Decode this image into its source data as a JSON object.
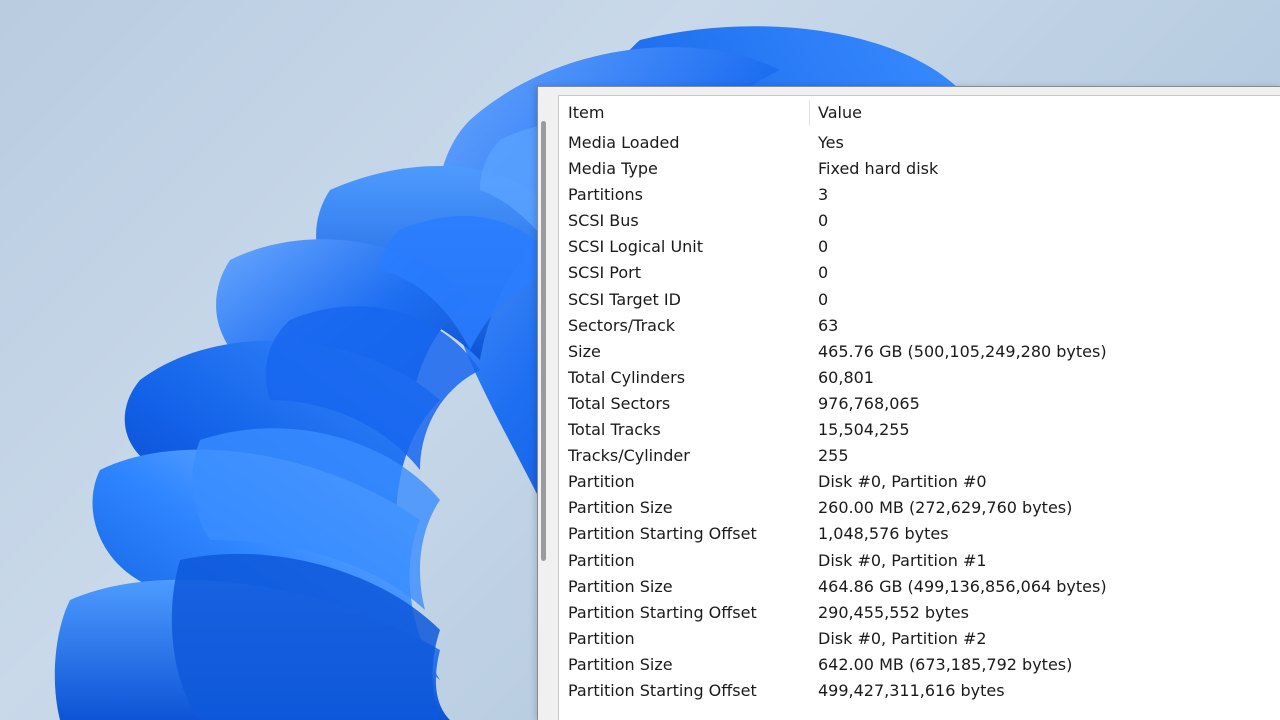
{
  "table": {
    "columns": [
      "Item",
      "Value"
    ],
    "rows": [
      {
        "item": "Media Loaded",
        "value": "Yes"
      },
      {
        "item": "Media Type",
        "value": "Fixed hard disk"
      },
      {
        "item": "Partitions",
        "value": "3"
      },
      {
        "item": "SCSI Bus",
        "value": "0"
      },
      {
        "item": "SCSI Logical Unit",
        "value": "0"
      },
      {
        "item": "SCSI Port",
        "value": "0"
      },
      {
        "item": "SCSI Target ID",
        "value": "0"
      },
      {
        "item": "Sectors/Track",
        "value": "63"
      },
      {
        "item": "Size",
        "value": "465.76 GB (500,105,249,280 bytes)"
      },
      {
        "item": "Total Cylinders",
        "value": "60,801"
      },
      {
        "item": "Total Sectors",
        "value": "976,768,065"
      },
      {
        "item": "Total Tracks",
        "value": "15,504,255"
      },
      {
        "item": "Tracks/Cylinder",
        "value": "255"
      },
      {
        "item": "Partition",
        "value": "Disk #0, Partition #0"
      },
      {
        "item": "Partition Size",
        "value": "260.00 MB (272,629,760 bytes)"
      },
      {
        "item": "Partition Starting Offset",
        "value": "1,048,576 bytes"
      },
      {
        "item": "Partition",
        "value": "Disk #0, Partition #1"
      },
      {
        "item": "Partition Size",
        "value": "464.86 GB (499,136,856,064 bytes)"
      },
      {
        "item": "Partition Starting Offset",
        "value": "290,455,552 bytes"
      },
      {
        "item": "Partition",
        "value": "Disk #0, Partition #2"
      },
      {
        "item": "Partition Size",
        "value": "642.00 MB (673,185,792 bytes)"
      },
      {
        "item": "Partition Starting Offset",
        "value": "499,427,311,616 bytes"
      }
    ]
  },
  "colors": {
    "wallpaper_bg": "#c3d4e6",
    "bloom_blue": "#1a6cf0",
    "window_bg": "#f0f0f0",
    "list_bg": "#ffffff",
    "text": "#1a1a1a"
  },
  "icons": {
    "wallpaper": "windows-11-bloom"
  }
}
